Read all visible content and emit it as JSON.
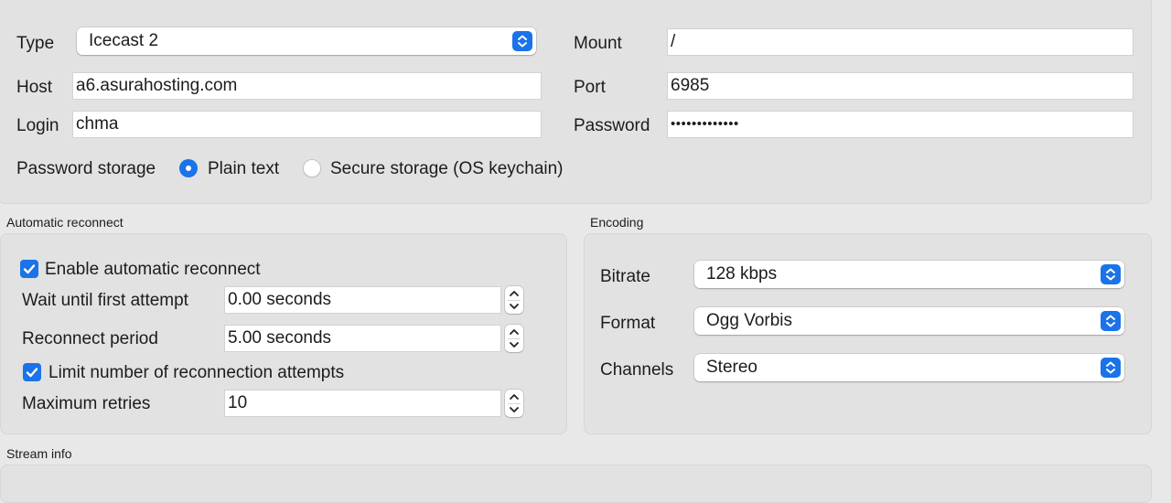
{
  "server": {
    "type_label": "Type",
    "type_value": "Icecast 2",
    "mount_label": "Mount",
    "mount_value": "/",
    "host_label": "Host",
    "host_value": "a6.asurahosting.com",
    "port_label": "Port",
    "port_value": "6985",
    "login_label": "Login",
    "login_value": "chma",
    "password_label": "Password",
    "password_value": "•••••••••••••",
    "storage_label": "Password storage",
    "storage_options": [
      {
        "label": "Plain text",
        "selected": true
      },
      {
        "label": "Secure storage (OS keychain)",
        "selected": false
      }
    ]
  },
  "reconnect": {
    "title": "Automatic reconnect",
    "enable_label": "Enable automatic reconnect",
    "enable_checked": true,
    "wait_label": "Wait until first attempt",
    "wait_value": "0.00 seconds",
    "period_label": "Reconnect period",
    "period_value": "5.00 seconds",
    "limit_label": "Limit number of reconnection attempts",
    "limit_checked": true,
    "retries_label": "Maximum retries",
    "retries_value": "10"
  },
  "encoding": {
    "title": "Encoding",
    "bitrate_label": "Bitrate",
    "bitrate_value": "128 kbps",
    "format_label": "Format",
    "format_value": "Ogg Vorbis",
    "channels_label": "Channels",
    "channels_value": "Stereo"
  },
  "stream_info": {
    "title": "Stream info"
  },
  "colors": {
    "accent": "#1a73e8",
    "window_bg": "#e8e8e8",
    "group_bg": "#e2e2e2"
  },
  "icons": {
    "popup_arrows": "chevron-up-down-icon",
    "radio": "radio-dot-icon",
    "checkbox": "checkmark-icon",
    "stepper": "stepper-arrows-icon"
  }
}
